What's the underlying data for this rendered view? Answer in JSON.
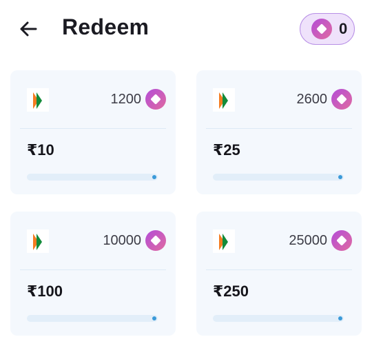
{
  "header": {
    "title": "Redeem",
    "back_icon": "arrow-left-icon",
    "balance": "0",
    "balance_icon": "coin-icon"
  },
  "colors": {
    "coin_gradient_start": "#b34dd8",
    "coin_gradient_end": "#e06aa0",
    "pill_background": "#efe2fb",
    "pill_border": "#b78ee6",
    "card_background": "#f4f8fd",
    "progress_track": "#e2eef9",
    "progress_dot": "#3b9ad9"
  },
  "rewards": [
    {
      "points": "1200",
      "amount": "₹10",
      "logo": "bhim-upi-logo",
      "progress": 0
    },
    {
      "points": "2600",
      "amount": "₹25",
      "logo": "bhim-upi-logo",
      "progress": 0
    },
    {
      "points": "10000",
      "amount": "₹100",
      "logo": "bhim-upi-logo",
      "progress": 0
    },
    {
      "points": "25000",
      "amount": "₹250",
      "logo": "bhim-upi-logo",
      "progress": 0
    }
  ]
}
